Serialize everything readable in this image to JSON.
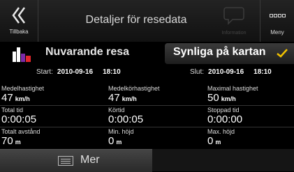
{
  "header": {
    "back_label": "Tillbaka",
    "title": "Detaljer för resedata",
    "info_label": "Information",
    "menu_label": "Meny"
  },
  "trip": {
    "name": "Nuvarande resa",
    "visible_label": "Synliga på kartan",
    "visible_checked": true,
    "start_label": "Start:",
    "start_date": "2010-09-16",
    "start_time": "18:10",
    "end_label": "Slut:",
    "end_date": "2010-09-16",
    "end_time": "18:10"
  },
  "stats": [
    {
      "label": "Medelhastighet",
      "value": "47",
      "unit": "km/h"
    },
    {
      "label": "Medelkörhastighet",
      "value": "47",
      "unit": "km/h"
    },
    {
      "label": "Maximal hastighet",
      "value": "50",
      "unit": "km/h"
    },
    {
      "label": "Total tid",
      "value": "0:00:05",
      "unit": ""
    },
    {
      "label": "Körtid",
      "value": "0:00:05",
      "unit": ""
    },
    {
      "label": "Stoppad tid",
      "value": "0:00:00",
      "unit": ""
    },
    {
      "label": "Totalt avstånd",
      "value": "70",
      "unit": "m"
    },
    {
      "label": "Min. höjd",
      "value": "0",
      "unit": "m"
    },
    {
      "label": "Max. höjd",
      "value": "0",
      "unit": "m"
    }
  ],
  "footer": {
    "more_label": "Mer"
  },
  "colors": {
    "accent_check": "#f2c200",
    "trip_icon_purple": "#7b2aa8",
    "trip_icon_red": "#e2262b"
  },
  "icons": {
    "back": "double-chevron-left-icon",
    "info": "speech-bubble-icon",
    "menu": "grid-icon",
    "trip": "bar-chart-icon",
    "check": "check-icon",
    "more": "list-icon"
  }
}
